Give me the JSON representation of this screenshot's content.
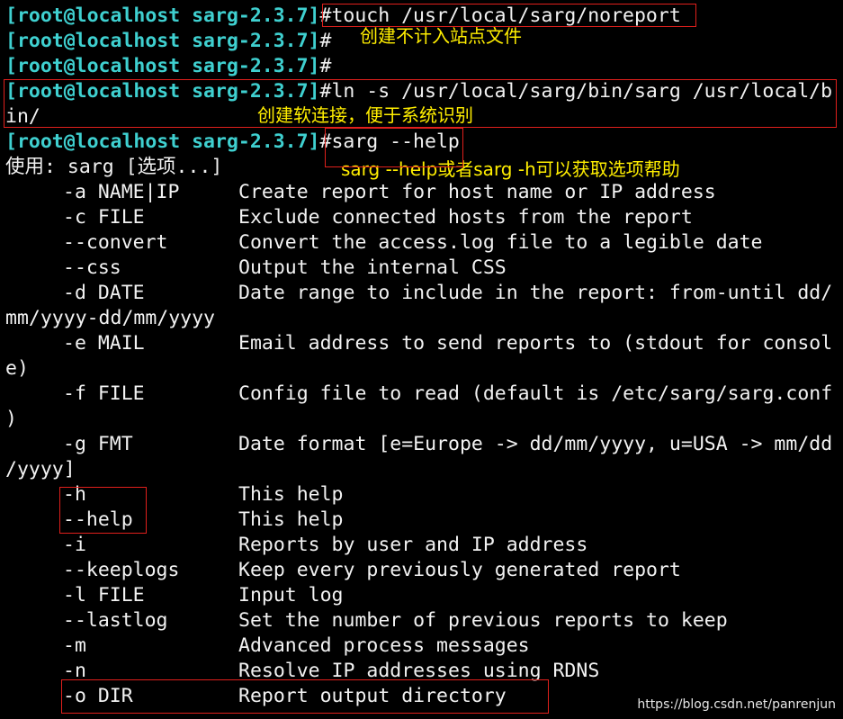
{
  "terminal": {
    "prompt": "[root@localhost sarg-2.3.7]",
    "commands": [
      {
        "text": "#touch /usr/local/sarg/noreport"
      },
      {
        "text": "#"
      },
      {
        "text": "#"
      },
      {
        "text": "#ln -s /usr/local/sarg/bin/sarg /usr/local/b"
      },
      {
        "text": "#sarg --help"
      }
    ],
    "ln_wrap": "in/",
    "usage": "使用: sarg [选项...]",
    "options": [
      {
        "opt": "-a NAME|IP",
        "desc": "Create report for host name or IP address"
      },
      {
        "opt": "-c FILE",
        "desc": "Exclude connected hosts from the report"
      },
      {
        "opt": "--convert",
        "desc": "Convert the access.log file to a legible date"
      },
      {
        "opt": "--css",
        "desc": "Output the internal CSS"
      },
      {
        "opt": "-d DATE",
        "desc": "Date range to include in the report: from-until dd/",
        "wrap": "mm/yyyy-dd/mm/yyyy"
      },
      {
        "opt": "-e MAIL",
        "desc": "Email address to send reports to (stdout for consol",
        "wrap": "e)"
      },
      {
        "opt": "-f FILE",
        "desc": "Config file to read (default is /etc/sarg/sarg.conf",
        "wrap": ")"
      },
      {
        "opt": "-g FMT",
        "desc": "Date format [e=Europe -> dd/mm/yyyy, u=USA -> mm/dd",
        "wrap": "/yyyy]"
      },
      {
        "opt": "-h",
        "desc": "This help"
      },
      {
        "opt": "--help",
        "desc": "This help"
      },
      {
        "opt": "-i",
        "desc": "Reports by user and IP address"
      },
      {
        "opt": "--keeplogs",
        "desc": "Keep every previously generated report"
      },
      {
        "opt": "-l FILE",
        "desc": "Input log"
      },
      {
        "opt": "--lastlog",
        "desc": "Set the number of previous reports to keep"
      },
      {
        "opt": "-m",
        "desc": "Advanced process messages"
      },
      {
        "opt": "-n",
        "desc": "Resolve IP addresses using RDNS"
      },
      {
        "opt": "-o DIR",
        "desc": "Report output directory"
      }
    ]
  },
  "annotations": {
    "noreport": "创建不计入站点文件",
    "symlink": "创建软连接，便于系统识别",
    "help": "sarg --help或者sarg -h可以获取选项帮助"
  },
  "watermark": "https://blog.csdn.net/panrenjun",
  "colors": {
    "background": "#000000",
    "prompt": "#3fd0d0",
    "text": "#f2f2f2",
    "annotation": "#ffee00",
    "highlight_box": "#e0201c"
  }
}
